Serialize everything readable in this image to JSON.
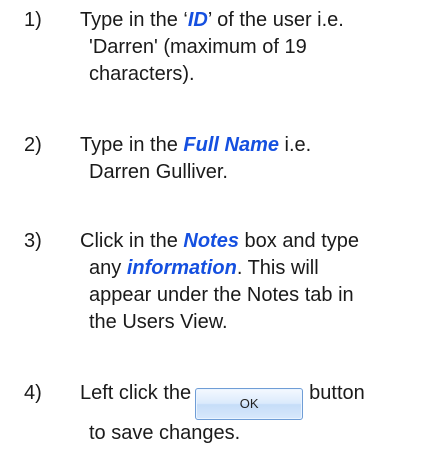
{
  "steps": [
    {
      "number": "1)",
      "line1_pre": "Type in the ‘",
      "line1_kw": "ID",
      "line1_post": "’ of the user i.e.",
      "line2": "'Darren' (maximum of 19",
      "line3": "characters)."
    },
    {
      "number": "2)",
      "line1_pre": "Type in the ",
      "line1_kw": "Full Name",
      "line1_post": " i.e.",
      "line2": "Darren Gulliver."
    },
    {
      "number": "3)",
      "line1_pre": "Click in the ",
      "line1_kw": "Notes",
      "line1_post": " box and type",
      "line2_pre": "any ",
      "line2_kw": "information",
      "line2_post": ". This will",
      "line3": "appear under the Notes tab in",
      "line4": "the Users View."
    },
    {
      "number": "4)",
      "line1_pre": "Left click the",
      "button_label": "OK",
      "line1_post": "button",
      "line2": "to save changes."
    }
  ],
  "colors": {
    "keyword": "#1550e0",
    "text": "#1a1a1a"
  }
}
